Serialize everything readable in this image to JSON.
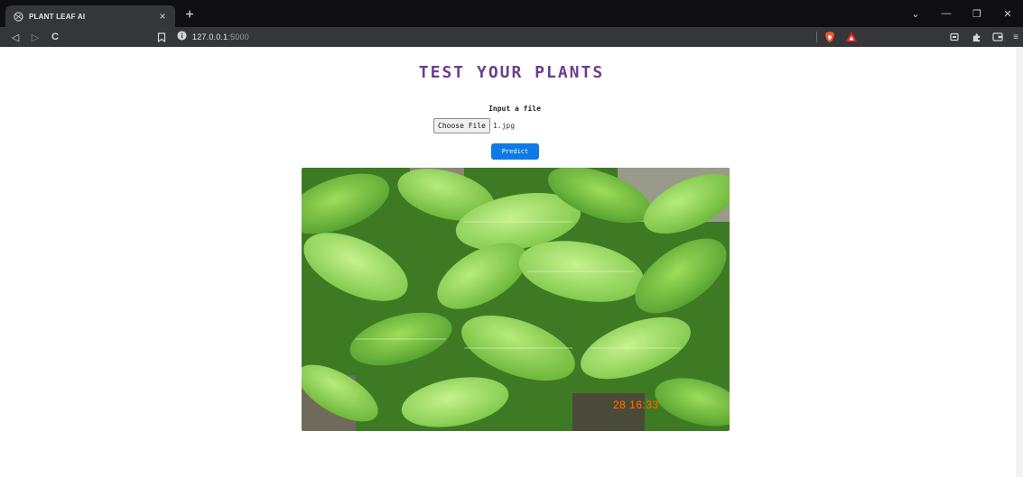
{
  "tab": {
    "title": "PLANT LEAF AI",
    "close_glyph": "×",
    "new_tab_glyph": "+"
  },
  "window_controls": {
    "dropdown_glyph": "⌄",
    "minimize_glyph": "—",
    "restore_glyph": "❐",
    "close_glyph": "✕"
  },
  "toolbar": {
    "back_glyph": "◁",
    "forward_glyph": "▷",
    "reload_glyph": "C",
    "menu_glyph": "≡",
    "url_host": "127.0.0.1",
    "url_port": ":5000"
  },
  "page": {
    "title": "TEST YOUR PLANTS",
    "input_label": "Input a file",
    "choose_file_label": "Choose File",
    "file_name": "1.jpg",
    "predict_label": "Predict",
    "image_stamp": "28 16:33"
  },
  "colors": {
    "title": "#6a3f8e",
    "predict_button": "#0d7ae6",
    "tabstrip": "#0f0f12",
    "toolbar": "#35363a",
    "stamp": "#ff6a00"
  },
  "icons": {
    "tab_favicon": "globe-icon",
    "bookmark": "bookmark-icon",
    "site_info": "info-icon",
    "brave_shield": "brave-lion-icon",
    "brave_rewards": "triangle-rewards-icon",
    "extension_a": "media-icon",
    "extensions": "puzzle-icon",
    "wallet": "wallet-icon"
  }
}
